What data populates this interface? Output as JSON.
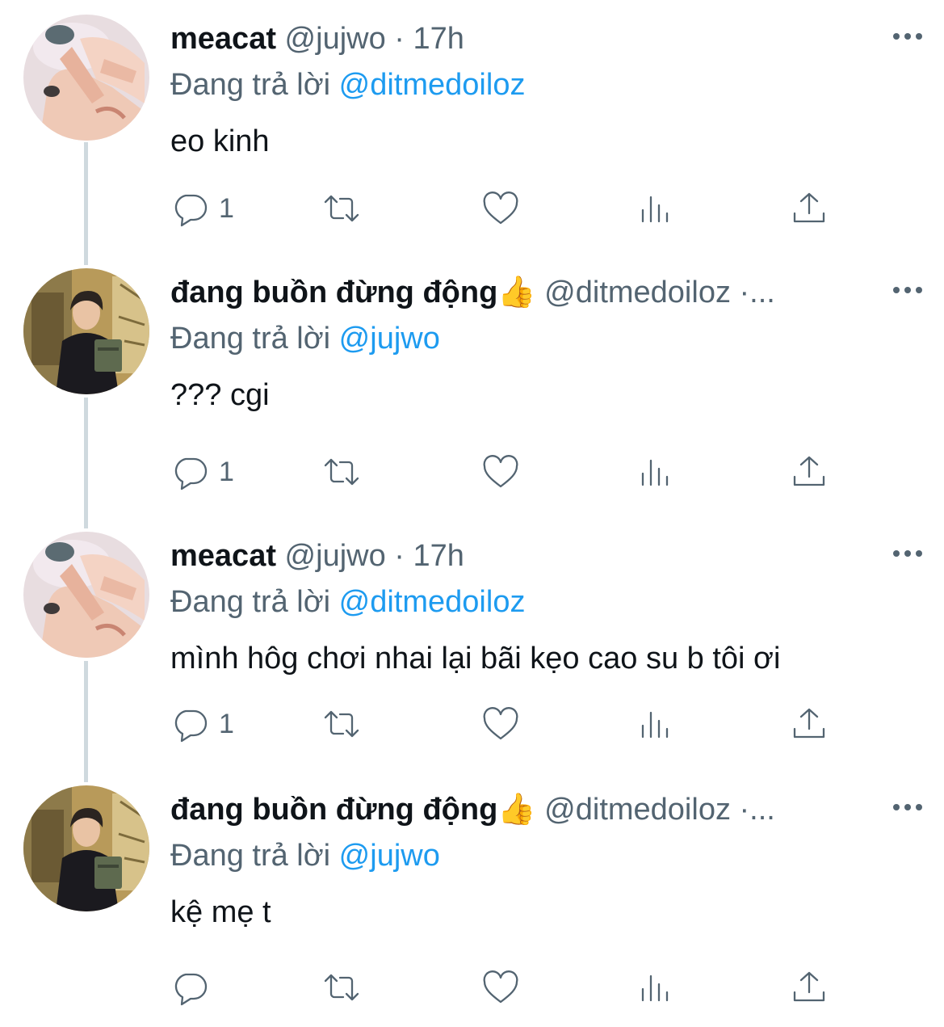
{
  "tweets": [
    {
      "name": "meacat",
      "handle": "@jujwo",
      "separator": "·",
      "time": "17h",
      "reply_prefix": "Đang trả lời",
      "reply_to": "@ditmedoiloz",
      "text": "eo kinh",
      "reply_count": "1"
    },
    {
      "name": "đang buồn đừng động👍",
      "handle": "@ditmedoiloz",
      "separator": "·...",
      "time": "",
      "reply_prefix": "Đang trả lời",
      "reply_to": "@jujwo",
      "text": "??? cgi",
      "reply_count": "1"
    },
    {
      "name": "meacat",
      "handle": "@jujwo",
      "separator": "·",
      "time": "17h",
      "reply_prefix": "Đang trả lời",
      "reply_to": "@ditmedoiloz",
      "text": "mình hôg chơi nhai lại bãi kẹo cao su b tôi ơi",
      "reply_count": "1"
    },
    {
      "name": "đang buồn đừng động👍",
      "handle": "@ditmedoiloz",
      "separator": "·...",
      "time": "",
      "reply_prefix": "Đang trả lời",
      "reply_to": "@jujwo",
      "text": "kệ mẹ t",
      "reply_count": ""
    }
  ],
  "icons": {
    "reply": "speech-bubble-icon",
    "retweet": "retweet-arrows-icon",
    "like": "heart-icon",
    "views": "bar-chart-icon",
    "share": "share-upload-icon",
    "more": "more-dots-icon"
  },
  "colors": {
    "link": "#1d9bf0",
    "secondary_text": "#536471",
    "thread_line": "#cfd9de"
  }
}
